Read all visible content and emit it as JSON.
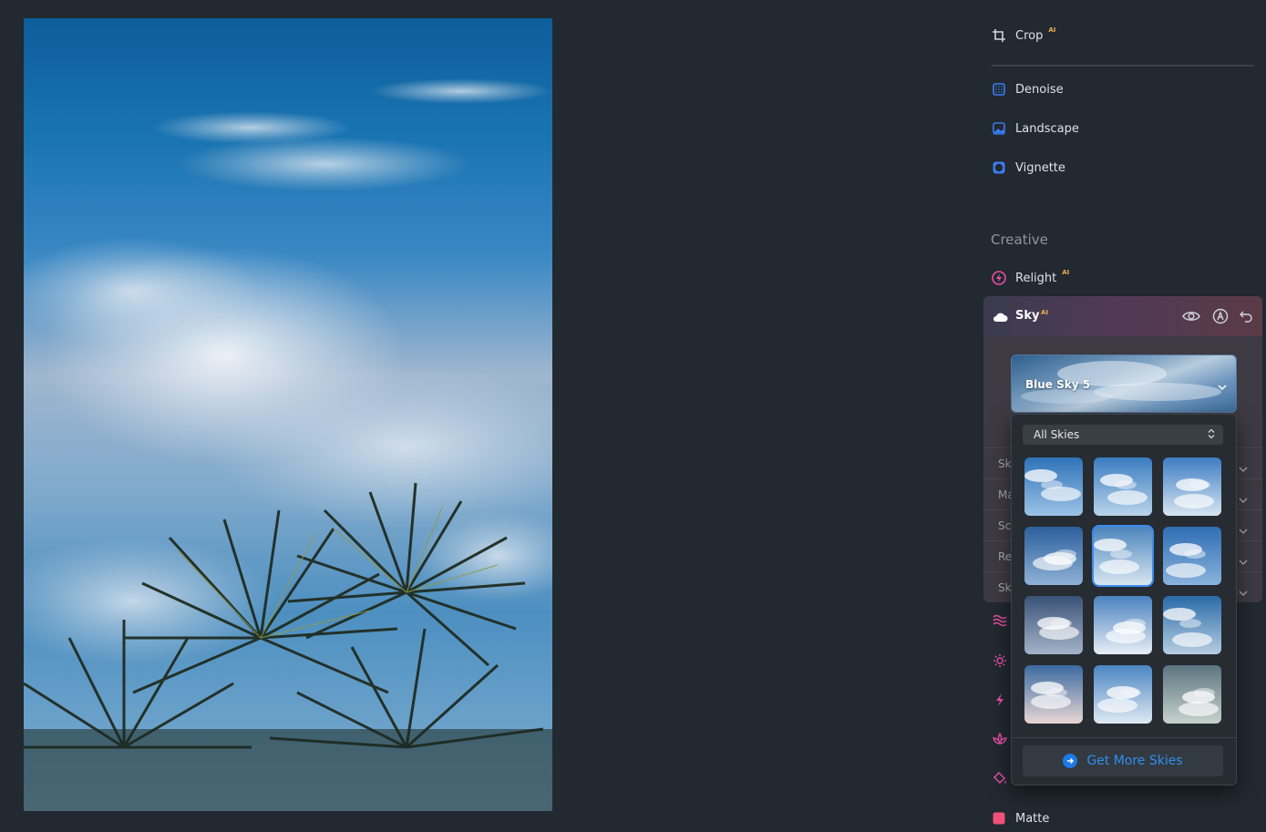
{
  "panel": {
    "tools": [
      {
        "label": "Crop",
        "ai": "AI",
        "icon": "crop-icon"
      },
      {
        "label": "Denoise",
        "icon": "denoise-icon"
      },
      {
        "label": "Landscape",
        "icon": "landscape-icon"
      },
      {
        "label": "Vignette",
        "icon": "vignette-icon"
      }
    ],
    "creative_title": "Creative",
    "relight": {
      "label": "Relight",
      "ai": "AI",
      "icon": "relight-icon"
    },
    "sky": {
      "label": "Sky",
      "ai": "AI",
      "icon": "cloud-icon",
      "selected_sky": "Blue Sky 5",
      "sub_rows": [
        "Sky",
        "Ma",
        "Sc",
        "Re",
        "Sky"
      ]
    },
    "matte": {
      "label": "Matte",
      "icon": "matte-icon",
      "color": "#f0507a"
    }
  },
  "sky_menu": {
    "filter_label": "All Skies",
    "selected_index": 4,
    "get_more_label": "Get More Skies"
  },
  "colors": {
    "accent_blue": "#2f8ff0",
    "ai_badge": "#e8b04a",
    "pink_icon": "#e64fa6"
  }
}
